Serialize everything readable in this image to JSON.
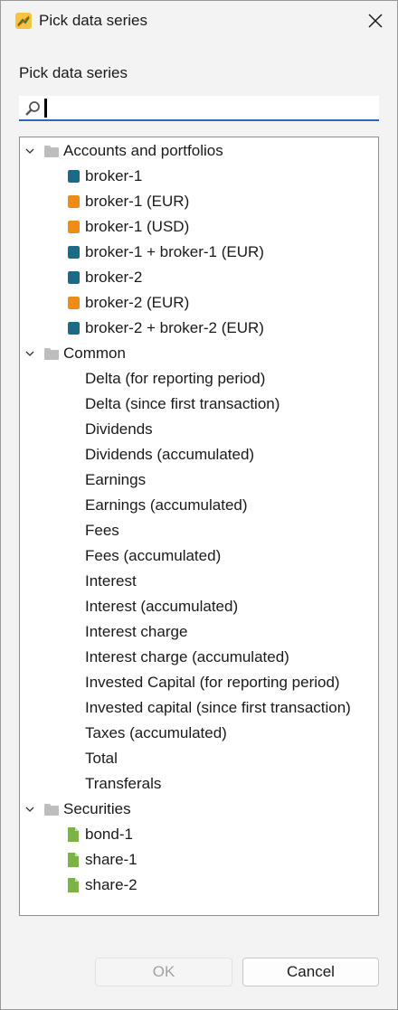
{
  "window": {
    "title": "Pick data series",
    "accent_color": "#2a6ab8"
  },
  "dialog": {
    "section_label": "Pick data series",
    "search": {
      "value": "",
      "placeholder": ""
    }
  },
  "tree": {
    "groups": [
      {
        "label": "Accounts and portfolios",
        "expanded": true,
        "icon": "folder-icon",
        "items": [
          {
            "label": "broker-1",
            "icon": "portfolio-square-icon",
            "color": "#1b6a86"
          },
          {
            "label": "broker-1 (EUR)",
            "icon": "account-square-icon",
            "color": "#ef8c15"
          },
          {
            "label": "broker-1 (USD)",
            "icon": "account-square-icon",
            "color": "#ef8c15"
          },
          {
            "label": "broker-1 + broker-1 (EUR)",
            "icon": "portfolio-square-icon",
            "color": "#1b6a86"
          },
          {
            "label": "broker-2",
            "icon": "portfolio-square-icon",
            "color": "#1b6a86"
          },
          {
            "label": "broker-2 (EUR)",
            "icon": "account-square-icon",
            "color": "#ef8c15"
          },
          {
            "label": "broker-2 + broker-2 (EUR)",
            "icon": "portfolio-square-icon",
            "color": "#1b6a86"
          }
        ]
      },
      {
        "label": "Common",
        "expanded": true,
        "icon": "folder-icon",
        "items": [
          {
            "label": "Delta (for reporting period)"
          },
          {
            "label": "Delta (since first transaction)"
          },
          {
            "label": "Dividends"
          },
          {
            "label": "Dividends (accumulated)"
          },
          {
            "label": "Earnings"
          },
          {
            "label": "Earnings (accumulated)"
          },
          {
            "label": "Fees"
          },
          {
            "label": "Fees (accumulated)"
          },
          {
            "label": "Interest"
          },
          {
            "label": "Interest (accumulated)"
          },
          {
            "label": "Interest charge"
          },
          {
            "label": "Interest charge (accumulated)"
          },
          {
            "label": "Invested Capital (for reporting period)"
          },
          {
            "label": "Invested capital (since first transaction)"
          },
          {
            "label": "Taxes (accumulated)"
          },
          {
            "label": "Total"
          },
          {
            "label": "Transferals"
          }
        ]
      },
      {
        "label": "Securities",
        "expanded": true,
        "icon": "folder-icon",
        "items": [
          {
            "label": "bond-1",
            "icon": "security-document-icon",
            "color": "#7cb342"
          },
          {
            "label": "share-1",
            "icon": "security-document-icon",
            "color": "#7cb342"
          },
          {
            "label": "share-2",
            "icon": "security-document-icon",
            "color": "#7cb342"
          }
        ]
      }
    ]
  },
  "buttons": {
    "ok": {
      "label": "OK",
      "enabled": false
    },
    "cancel": {
      "label": "Cancel",
      "enabled": true
    }
  }
}
